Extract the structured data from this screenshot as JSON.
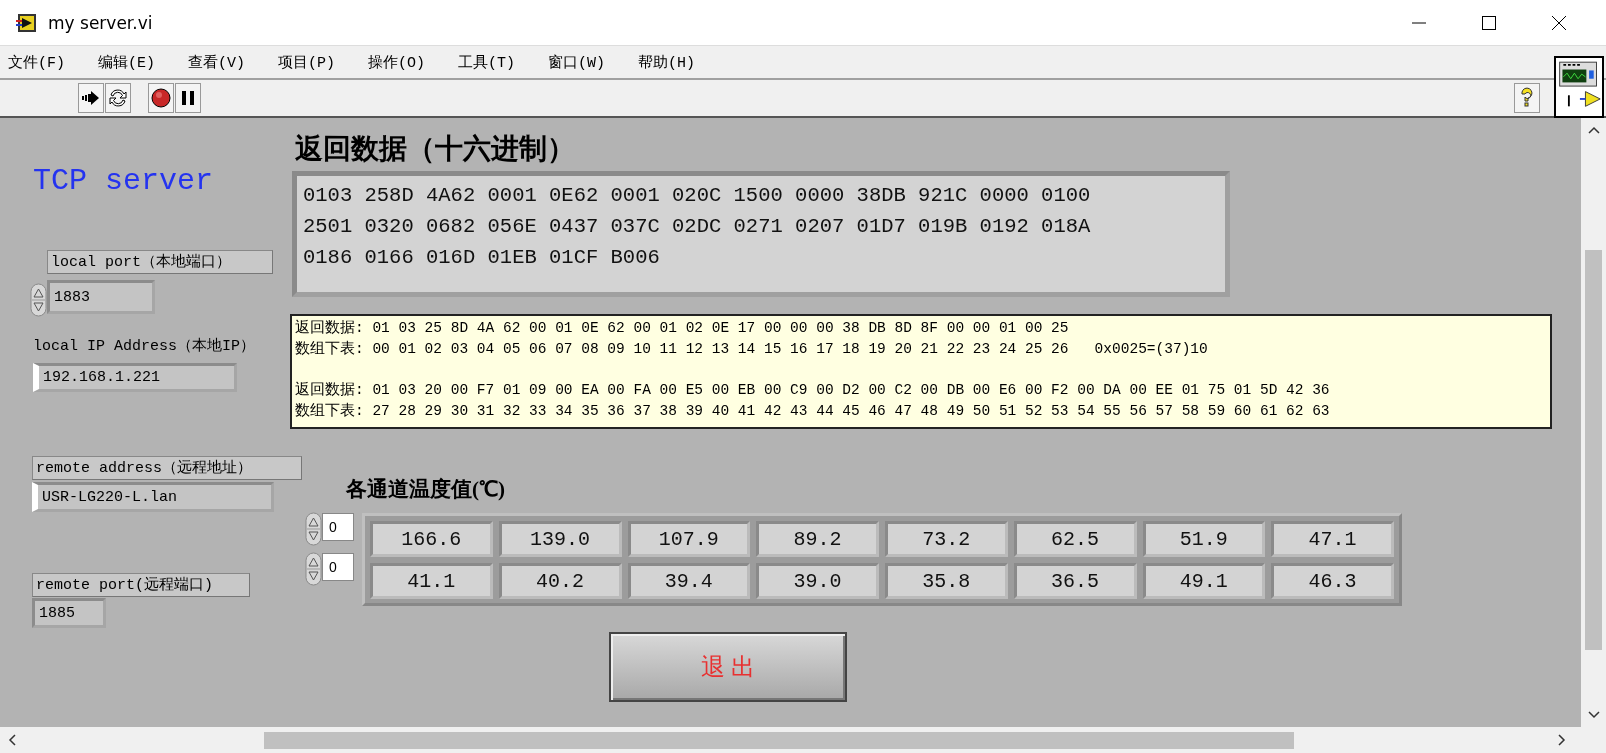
{
  "window": {
    "title": "my server.vi"
  },
  "menu": [
    "文件(F)",
    "编辑(E)",
    "查看(V)",
    "项目(P)",
    "操作(O)",
    "工具(T)",
    "窗口(W)",
    "帮助(H)"
  ],
  "panel": {
    "heading": "TCP server",
    "local_port": {
      "label": "local port（本地端口）",
      "value": "1883"
    },
    "local_ip": {
      "label": "local IP Address（本地IP）",
      "value": "192.168.1.221"
    },
    "remote_address": {
      "label": "remote address（远程地址）",
      "value": "USR-LG220-L.lan"
    },
    "remote_port": {
      "label": "remote port(远程端口)",
      "value": "1885"
    },
    "hex_display": {
      "label": "返回数据（十六进制）",
      "lines": [
        "0103 258D 4A62 0001 0E62 0001 020C 1500 0000 38DB 921C 0000 0100",
        "2501 0320 0682 056E 0437 037C 02DC 0271 0207 01D7 019B 0192 018A",
        "0186 0166 016D 01EB 01CF B006"
      ]
    },
    "note": {
      "blocks": [
        {
          "lines": [
            "返回数据: 01 03 25 8D 4A 62 00 01 0E 62 00 01 02 0E 17 00 00 00 38 DB 8D 8F 00 00 01 00 25",
            "数组下表: 00 01 02 03 04 05 06 07 08 09 10 11 12 13 14 15 16 17 18 19 20 21 22 23 24 25 26   0x0025=(37)10"
          ]
        },
        {
          "lines": [
            "返回数据: 01 03 20 00 F7 01 09 00 EA 00 FA 00 E5 00 EB 00 C9 00 D2 00 C2 00 DB 00 E6 00 F2 00 DA 00 EE 01 75 01 5D 42 36",
            "数组下表: 27 28 29 30 31 32 33 34 35 36 37 38 39 40 41 42 43 44 45 46 47 48 49 50 51 52 53 54 55 56 57 58 59 60 61 62 63"
          ]
        }
      ]
    },
    "temperatures": {
      "label": "各通道温度值(℃)",
      "indices": [
        "0",
        "0"
      ],
      "rows": [
        [
          "166.6",
          "139.0",
          "107.9",
          "89.2",
          "73.2",
          "62.5",
          "51.9",
          "47.1"
        ],
        [
          "41.1",
          "40.2",
          "39.4",
          "39.0",
          "35.8",
          "36.5",
          "49.1",
          "46.3"
        ]
      ]
    },
    "exit_button": {
      "label": "退 出"
    }
  }
}
